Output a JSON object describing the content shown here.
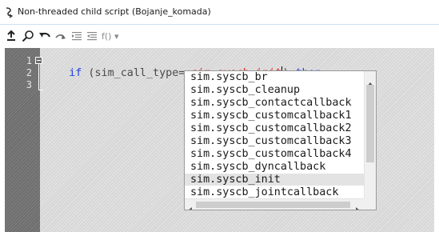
{
  "window": {
    "title": "Non-threaded child script (Bojanje_komada)",
    "icon": "script-icon"
  },
  "toolbar": {
    "buttons": [
      {
        "name": "insert-icon"
      },
      {
        "name": "search-icon"
      },
      {
        "name": "undo-icon"
      },
      {
        "name": "redo-icon"
      },
      {
        "name": "indent-icon"
      },
      {
        "name": "outdent-icon"
      }
    ],
    "functions_label": "f() ▾"
  },
  "editor": {
    "line_numbers": [
      "1",
      "2",
      "3"
    ],
    "line1": {
      "keyword_if": "if",
      "pre": " (sim_call_type==",
      "constant": "sim.syscb_init",
      "post": ") ",
      "keyword_then": "then"
    }
  },
  "autocomplete": {
    "items": [
      "sim.syscb_br",
      "sim.syscb_cleanup",
      "sim.syscb_contactcallback",
      "sim.syscb_customcallback1",
      "sim.syscb_customcallback2",
      "sim.syscb_customcallback3",
      "sim.syscb_customcallback4",
      "sim.syscb_dyncallback",
      "sim.syscb_init",
      "sim.syscb_jointcallback"
    ],
    "selected_index": 8
  },
  "colors": {
    "keyword": "#2440e0",
    "constant": "#d61a1a",
    "text": "#4a4a4a",
    "gutter": "#6f6f6f",
    "editor_bg": "#d7d7d7"
  }
}
